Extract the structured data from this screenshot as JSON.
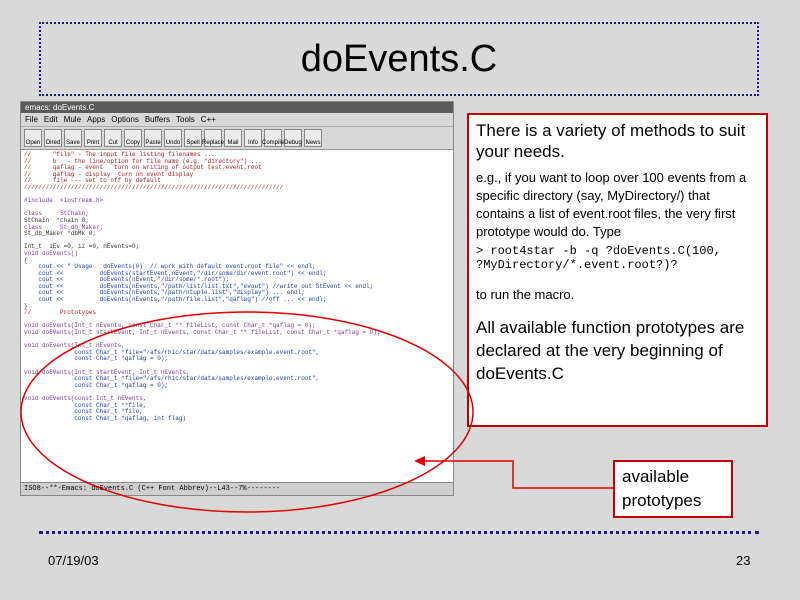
{
  "slide": {
    "title": "doEvents.C",
    "date": "07/19/03",
    "page_number": "23"
  },
  "editor": {
    "window_title": "emacs: doEvents.C",
    "menu": [
      "File",
      "Edit",
      "Mule",
      "Apps",
      "Options",
      "Buffers",
      "Tools",
      "C++"
    ],
    "toolbar": [
      "Open",
      "Dired",
      "Save",
      "Print",
      "Cut",
      "Copy",
      "Paste",
      "Undo",
      "Spell",
      "Replace",
      "Mail",
      "Info",
      "Compile",
      "Debug",
      "News"
    ],
    "code_lines": [
      "//      \"file\" - The input file listing filenames ...",
      "//      b   - the line/option for file name (e.g. \"directory\") ...",
      "//      qaflag - event   turn on writing of output test.event.root",
      "//      qaflag - display  turn on event display",
      "//      file --- set to off by default",
      "////////////////////////////////////////////////////////////////////////",
      "",
      "#include  <iostream.h>",
      "",
      "class     StChain;",
      "StChain  *chain 0;",
      "class     St_db_Maker;",
      "St_db_Maker *dbMk 0;",
      "",
      "Int_t  iEv =0, iz =0, nEvents=0;",
      "void doEvents()",
      "{",
      "    cout << \" Usage   doEvents(0)  // work with default event.root file\" << endl;",
      "    cout <<          doEvents(startEvent,nEvent,\"/dir/some/dir/event.root\") << endl;",
      "    cout <<          doEvents(nEvent,\"/dir/some/*.root\");",
      "    cout <<          doEvents(nEvents,\"/path/list/list.txt\",\"evout\") //write out StEvent << endl;",
      "    cout <<          doEvents(nEvents,\"/path/ntuple.list\",\"display\") ... endl;",
      "    cout <<          doEvents(nEvents,\"/path/file.list\",\"qaflag\") //off ... << endl;",
      "}",
      "//        Prototypes",
      "",
      "void doEvents(Int_t nEvents, const Char_t ** fileList, const Char_t *qaflag = 0);",
      "void doEvents(Int_t startEvent, Int_t nEvents, const Char_t ** fileList, const Char_t *qaflag = 0);",
      "",
      "void doEvents(Int_t nEvents,",
      "              const Char_t *file=\"/afs/rhic/star/data/samples/example.event.root\",",
      "              const Char_t *qaflag = 0);",
      "",
      "void doEvents(Int_t startEvent, Int_t nEvents,",
      "              const Char_t *file=\"/afs/rhic/star/data/samples/example.event.root\",",
      "              const Char_t *qaflag = 0);",
      "",
      "void doEvents(const Int_t nEvents,",
      "              const Char_t **file,",
      "              const Char_t *file,",
      "              const Char_t *qaflag, int flag)"
    ],
    "status_line": "ISO8--**-Emacs: doEvents.C      (C++ Font Abbrev)--L43--7%--------"
  },
  "textbox": {
    "p1": "There is a variety of methods to suit your needs.",
    "p2": "e.g., if you want to loop over 100 events from a specific directory (say, MyDirectory/) that contains a list of event.root files, the very first prototype would do. Type",
    "command": "> root4star -b -q ?doEvents.C(100,\n?MyDirectory/*.event.root?)?",
    "p3": "to run the macro.",
    "p4": "All available function prototypes are declared  at the very beginning of doEvents.C"
  },
  "callout": {
    "label": "available prototypes"
  },
  "colors": {
    "background": "#d9d9d9",
    "accent_red": "#c00000",
    "dotted_border": "#1a1a8c"
  }
}
